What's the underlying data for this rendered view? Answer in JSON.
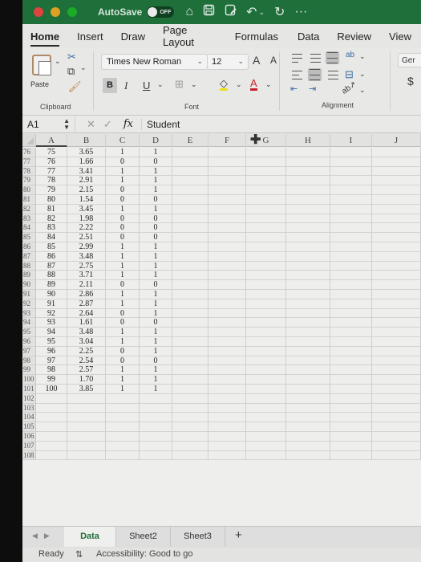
{
  "titlebar": {
    "autosave_label": "AutoSave",
    "autosave_state": "OFF",
    "icons": [
      "home-icon",
      "save-icon",
      "save-as-icon",
      "undo-icon",
      "redo-icon",
      "more-icon"
    ],
    "more": "···"
  },
  "tabs": [
    {
      "label": "Home",
      "active": true
    },
    {
      "label": "Insert"
    },
    {
      "label": "Draw"
    },
    {
      "label": "Page Layout"
    },
    {
      "label": "Formulas"
    },
    {
      "label": "Data"
    },
    {
      "label": "Review"
    },
    {
      "label": "View"
    }
  ],
  "ribbon": {
    "clipboard": {
      "paste_label": "Paste",
      "group_label": "Clipboard"
    },
    "font": {
      "name": "Times New Roman",
      "size": "12",
      "bold": "B",
      "italic": "I",
      "underline": "U",
      "grow": "A",
      "shrink": "A",
      "font_color": "A",
      "group_label": "Font",
      "fill_color": "#e8e020",
      "text_color": "#c8202a"
    },
    "alignment": {
      "group_label": "Alignment",
      "wrap": "ab"
    },
    "number": {
      "format": "Ger",
      "currency": "$"
    }
  },
  "formula_bar": {
    "name_box": "A1",
    "cancel": "✕",
    "enter": "✓",
    "fx": "fx",
    "content": "Student"
  },
  "columns": [
    "A",
    "B",
    "C",
    "D",
    "E",
    "F",
    "G",
    "H",
    "I",
    "J"
  ],
  "rows": [
    {
      "n": "76",
      "cells": [
        "75",
        "3.65",
        "1",
        "1"
      ]
    },
    {
      "n": "77",
      "cells": [
        "76",
        "1.66",
        "0",
        "0"
      ]
    },
    {
      "n": "78",
      "cells": [
        "77",
        "3.41",
        "1",
        "1"
      ]
    },
    {
      "n": "79",
      "cells": [
        "78",
        "2.91",
        "1",
        "1"
      ]
    },
    {
      "n": "80",
      "cells": [
        "79",
        "2.15",
        "0",
        "1"
      ]
    },
    {
      "n": "81",
      "cells": [
        "80",
        "1.54",
        "0",
        "0"
      ]
    },
    {
      "n": "82",
      "cells": [
        "81",
        "3.45",
        "1",
        "1"
      ]
    },
    {
      "n": "83",
      "cells": [
        "82",
        "1.98",
        "0",
        "0"
      ]
    },
    {
      "n": "84",
      "cells": [
        "83",
        "2.22",
        "0",
        "0"
      ]
    },
    {
      "n": "85",
      "cells": [
        "84",
        "2.51",
        "0",
        "0"
      ]
    },
    {
      "n": "86",
      "cells": [
        "85",
        "2.99",
        "1",
        "1"
      ]
    },
    {
      "n": "87",
      "cells": [
        "86",
        "3.48",
        "1",
        "1"
      ]
    },
    {
      "n": "88",
      "cells": [
        "87",
        "2.75",
        "1",
        "1"
      ]
    },
    {
      "n": "89",
      "cells": [
        "88",
        "3.71",
        "1",
        "1"
      ]
    },
    {
      "n": "90",
      "cells": [
        "89",
        "2.11",
        "0",
        "0"
      ]
    },
    {
      "n": "91",
      "cells": [
        "90",
        "2.86",
        "1",
        "1"
      ]
    },
    {
      "n": "92",
      "cells": [
        "91",
        "2.87",
        "1",
        "1"
      ]
    },
    {
      "n": "93",
      "cells": [
        "92",
        "2.64",
        "0",
        "1"
      ]
    },
    {
      "n": "94",
      "cells": [
        "93",
        "1.61",
        "0",
        "0"
      ]
    },
    {
      "n": "95",
      "cells": [
        "94",
        "3.48",
        "1",
        "1"
      ]
    },
    {
      "n": "96",
      "cells": [
        "95",
        "3.04",
        "1",
        "1"
      ]
    },
    {
      "n": "97",
      "cells": [
        "96",
        "2.25",
        "0",
        "1"
      ]
    },
    {
      "n": "98",
      "cells": [
        "97",
        "2.54",
        "0",
        "0"
      ]
    },
    {
      "n": "99",
      "cells": [
        "98",
        "2.57",
        "1",
        "1"
      ]
    },
    {
      "n": "100",
      "cells": [
        "99",
        "1.70",
        "1",
        "1"
      ]
    },
    {
      "n": "101",
      "cells": [
        "100",
        "3.85",
        "1",
        "1"
      ]
    },
    {
      "n": "102",
      "cells": [
        "",
        "",
        "",
        ""
      ]
    },
    {
      "n": "103",
      "cells": [
        "",
        "",
        "",
        ""
      ]
    },
    {
      "n": "104",
      "cells": [
        "",
        "",
        "",
        ""
      ]
    },
    {
      "n": "105",
      "cells": [
        "",
        "",
        "",
        ""
      ]
    },
    {
      "n": "106",
      "cells": [
        "",
        "",
        "",
        ""
      ]
    },
    {
      "n": "107",
      "cells": [
        "",
        "",
        "",
        ""
      ]
    },
    {
      "n": "108",
      "cells": [
        "",
        "",
        "",
        ""
      ]
    }
  ],
  "sheets": [
    {
      "label": "Data",
      "active": true
    },
    {
      "label": "Sheet2"
    },
    {
      "label": "Sheet3"
    }
  ],
  "add_sheet": "+",
  "status": {
    "ready": "Ready",
    "accessibility": "Accessibility: Good to go"
  },
  "colors": {
    "titlebar_green": "#1f6f3a",
    "close": "#e0443e",
    "minimize": "#dea123",
    "zoom": "#1aab29"
  }
}
